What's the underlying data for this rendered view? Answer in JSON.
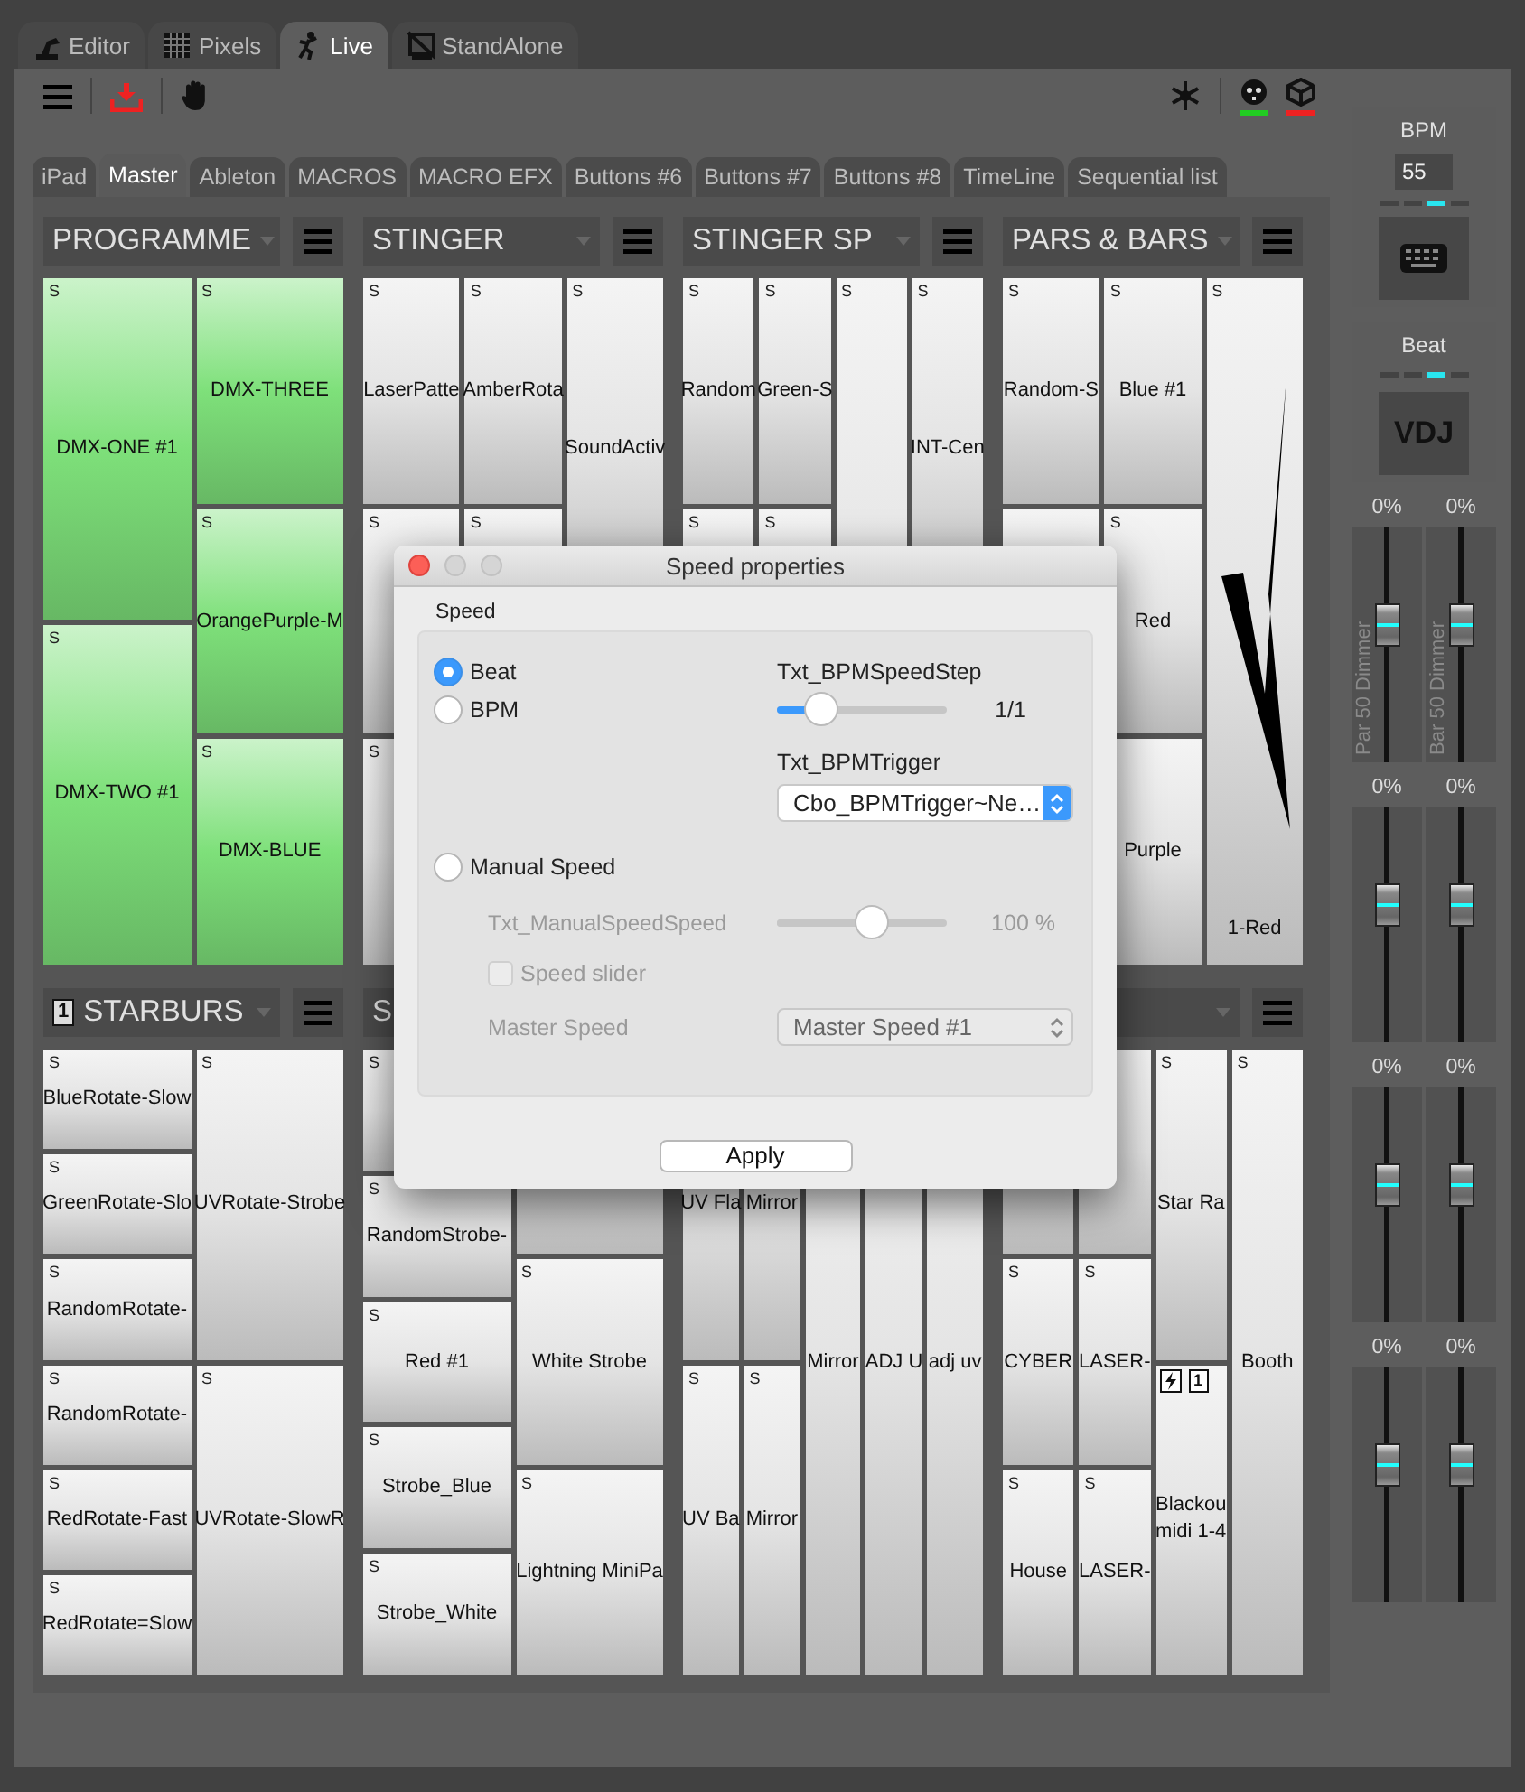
{
  "app_tabs": [
    {
      "label": "Editor",
      "selected": false
    },
    {
      "label": "Pixels",
      "selected": false
    },
    {
      "label": "Live",
      "selected": true
    },
    {
      "label": "StandAlone",
      "selected": false
    }
  ],
  "toolbar": {
    "status_lights": [
      {
        "color": "#22cc22"
      },
      {
        "color": "#ee2222"
      }
    ]
  },
  "sub_tabs": [
    {
      "label": "iPad",
      "selected": false
    },
    {
      "label": "Master",
      "selected": true
    },
    {
      "label": "Ableton",
      "selected": false
    },
    {
      "label": "MACROS",
      "selected": false
    },
    {
      "label": "MACRO EFX",
      "selected": false
    },
    {
      "label": "Buttons #6",
      "selected": false
    },
    {
      "label": "Buttons #7",
      "selected": false
    },
    {
      "label": "Buttons #8",
      "selected": false
    },
    {
      "label": "TimeLine",
      "selected": false
    },
    {
      "label": "Sequential list",
      "selected": false
    }
  ],
  "panel_rows": [
    [
      {
        "title": "PROGRAMME",
        "color": "#7ee07a",
        "columns": [
          [
            {
              "label": "DMX-ONE #1",
              "flag": "S"
            },
            {
              "label": "DMX-TWO #1",
              "flag": "S"
            }
          ],
          [
            {
              "label": "DMX-THREE",
              "flag": "S"
            },
            {
              "label": "OrangePurple-M",
              "flag": "S"
            },
            {
              "label": "DMX-BLUE",
              "flag": "S"
            }
          ]
        ]
      },
      {
        "title": "STINGER",
        "color": "#e4e4e4",
        "columns": [
          [
            {
              "label": "LaserPatte",
              "flag": "S"
            },
            {
              "flag": "S"
            },
            {
              "flag": "S"
            }
          ],
          [
            {
              "label": "AmberRota",
              "flag": "S"
            },
            {
              "flag": "S"
            },
            {}
          ],
          [
            {
              "label": "SoundActiv",
              "flag": "S"
            },
            {}
          ]
        ]
      },
      {
        "title": "STINGER SP",
        "color": "#e4e4e4",
        "columns": [
          [
            {
              "label": "Random",
              "flag": "S"
            },
            {
              "flag": "S"
            },
            {}
          ],
          [
            {
              "label": "Green-S",
              "flag": "S"
            },
            {
              "flag": "S"
            },
            {}
          ],
          [
            {
              "flag": "S"
            }
          ],
          [
            {
              "label": "INT-Cen",
              "flag": "S"
            },
            {}
          ]
        ]
      },
      {
        "title": "PARS & BARS",
        "color": "#e4e4e4",
        "columns": [
          [
            {
              "label": "Random-S",
              "flag": "S"
            },
            {},
            {}
          ],
          [
            {
              "label": "Blue #1",
              "flag": "S"
            },
            {
              "label": "Red",
              "flag": "S"
            },
            {
              "label": "Purple"
            }
          ],
          [
            {
              "label": "1-Red",
              "flag": "S",
              "kind": "arrow"
            }
          ]
        ]
      }
    ],
    [
      {
        "title": "STARBURS",
        "badge": "1",
        "color": "#e4e4e4",
        "columns": [
          [
            {
              "label": "BlueRotate-Slow",
              "flag": "S"
            },
            {
              "label": "GreenRotate-Slo",
              "flag": "S"
            },
            {
              "label": "RandomRotate-",
              "flag": "S"
            },
            {
              "label": "RandomRotate-",
              "flag": "S"
            },
            {
              "label": "RedRotate-Fast",
              "flag": "S"
            },
            {
              "label": "RedRotate=Slow",
              "flag": "S"
            }
          ],
          [
            {
              "label": "UVRotate-Strobe",
              "flag": "S"
            },
            {
              "label": "UVRotate-SlowR",
              "flag": "S"
            }
          ]
        ]
      },
      {
        "title": "S",
        "color": "#e4e4e4",
        "columns": [
          [
            {
              "flag": "S"
            },
            {
              "label": "RandomStrobe-",
              "flag": "S"
            },
            {
              "label": "Red #1",
              "flag": "S"
            },
            {
              "label": "Strobe_Blue",
              "flag": "S"
            },
            {
              "label": "Strobe_White",
              "flag": "S"
            }
          ],
          [
            {},
            {
              "label": "White Strobe",
              "flag": "S"
            },
            {
              "label": "Lightning MiniPa",
              "flag": "S"
            }
          ]
        ]
      },
      {
        "color": "#e4e4e4",
        "columns": [
          [
            {
              "label": "UV Fla"
            },
            {
              "label": "UV Ba",
              "flag": "S"
            }
          ],
          [
            {
              "label": "Mirror"
            },
            {
              "label": "Mirror",
              "flag": "S"
            }
          ],
          [
            {
              "label": "Mirror"
            }
          ],
          [
            {
              "label": "ADJ U"
            }
          ],
          [
            {
              "label": "adj uv"
            }
          ]
        ]
      },
      {
        "color": "#e4e4e4",
        "columns": [
          [
            {},
            {
              "label": "CYBER",
              "flag": "S"
            },
            {
              "label": "House",
              "flag": "S"
            }
          ],
          [
            {},
            {
              "label": "LASER-",
              "flag": "S"
            },
            {
              "label": "LASER-",
              "flag": "S"
            }
          ],
          [
            {
              "label": "Star Ra",
              "flag": "S"
            },
            {
              "label": "Blackou\nmidi 1-4",
              "badge": "1",
              "flash": true
            }
          ],
          [
            {
              "label": "Booth",
              "flag": "S"
            }
          ]
        ]
      }
    ]
  ],
  "sidebar": {
    "bpm": {
      "label": "BPM",
      "value": "55",
      "beats": [
        false,
        false,
        true,
        false
      ]
    },
    "beat": {
      "label": "Beat",
      "beats": [
        false,
        false,
        true,
        false
      ],
      "button": "VDJ"
    },
    "faders": [
      {
        "reading": "0%",
        "name": "Par 50 Dimmer",
        "level": 0.6
      },
      {
        "reading": "0%",
        "name": "Bar 50 Dimmer",
        "level": 0.6
      },
      {
        "reading": "0%",
        "level": 0.6
      },
      {
        "reading": "0%",
        "level": 0.6
      },
      {
        "reading": "0%",
        "level": 0.6
      },
      {
        "reading": "0%",
        "level": 0.6
      },
      {
        "reading": "0%",
        "level": 0.6
      },
      {
        "reading": "0%",
        "level": 0.6
      }
    ]
  },
  "dialog": {
    "title": "Speed properties",
    "group": "Speed",
    "modes": [
      {
        "label": "Beat",
        "selected": true
      },
      {
        "label": "BPM",
        "selected": false
      },
      {
        "label": "Manual Speed",
        "selected": false
      }
    ],
    "speed_step": {
      "label": "Txt_BPMSpeedStep",
      "level": 0.25,
      "reading": "1/1"
    },
    "trigger": {
      "label": "Txt_BPMTrigger",
      "value": "Cbo_BPMTrigger~Ne…"
    },
    "manual_speed": {
      "label": "Txt_ManualSpeedSpeed",
      "level": 0.55,
      "reading": "100 %",
      "disabled": true
    },
    "speed_slider": {
      "label": "Speed slider",
      "checked": false,
      "disabled": true
    },
    "master_speed": {
      "label": "Master Speed",
      "value": "Master Speed #1",
      "disabled": true
    },
    "apply": "Apply"
  }
}
